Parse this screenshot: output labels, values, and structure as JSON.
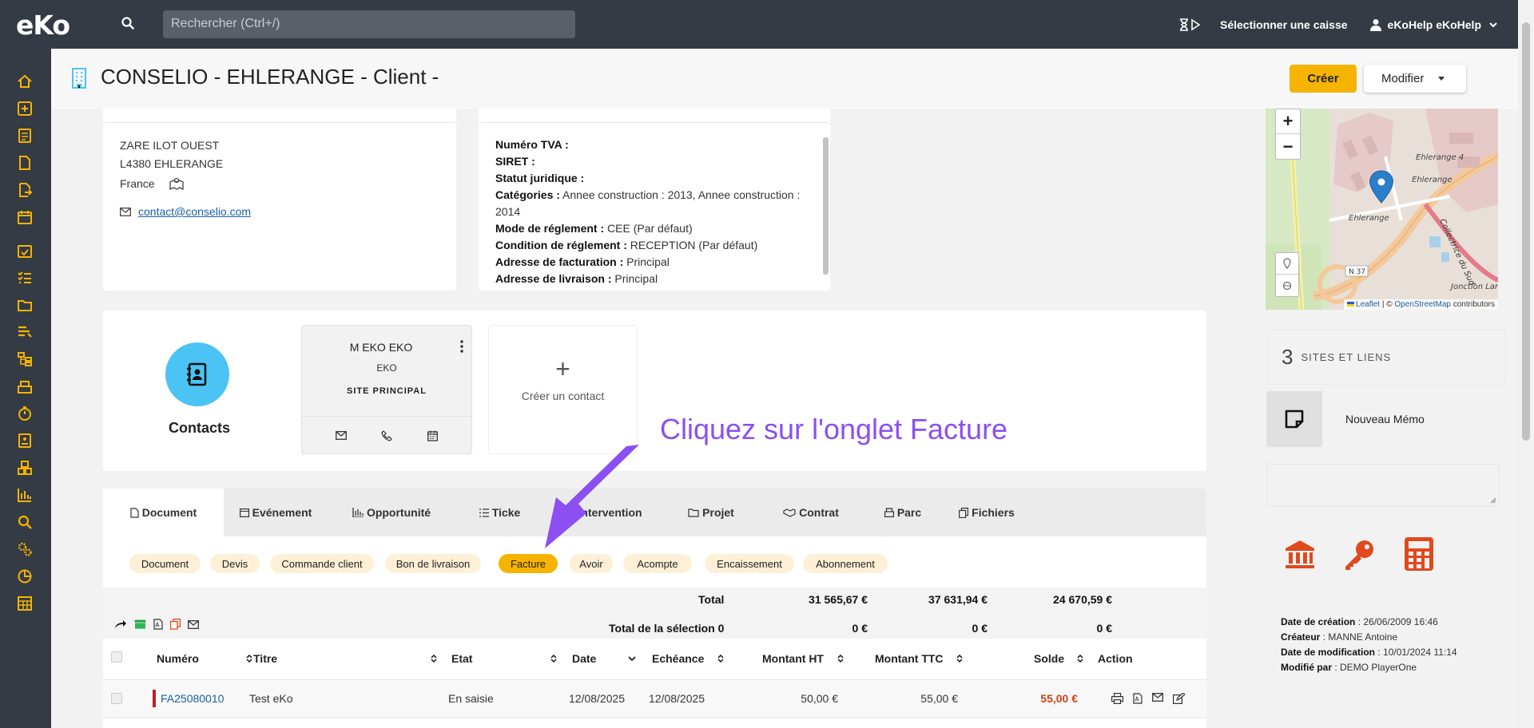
{
  "topbar": {
    "logo": "eKo",
    "search_placeholder": "Rechercher (Ctrl+/)",
    "caisse_label": "Sélectionner une caisse",
    "user_name": "eKoHelp eKoHelp"
  },
  "header": {
    "title": "CONSELIO - EHLERANGE - Client -",
    "create_label": "Créer",
    "modify_label": "Modifier"
  },
  "address": {
    "line1": "ZARE ILOT OUEST",
    "line2": "L4380 EHLERANGE",
    "country": "France",
    "email": "contact@conselio.com"
  },
  "info": {
    "tva_label": "Numéro TVA :",
    "siret_label": "SIRET :",
    "statut_label": "Statut juridique :",
    "categories_label": "Catégories :",
    "categories_value": " Annee construction : 2013, Annee construction : 2014",
    "reglement_label": "Mode de réglement :",
    "reglement_value": " CEE (Par défaut)",
    "condition_label": "Condition de réglement :",
    "condition_value": " RECEPTION (Par défaut)",
    "facturation_label": "Adresse de facturation :",
    "facturation_value": " Principal",
    "livraison_label": "Adresse de livraison :",
    "livraison_value": " Principal"
  },
  "map": {
    "zoom_in": "+",
    "zoom_out": "−",
    "attr_leaflet": "Leaflet",
    "attr_sep": " | © ",
    "attr_osm": "OpenStreetMap",
    "attr_contrib": " contributors",
    "labels": {
      "ehlerange4": "Ehlerange 4",
      "ehlerange": "Ehlerange",
      "ehlerange2": "Ehlerange",
      "n37": "N 37",
      "collectrice": "Collectrice du Sud",
      "jonction": "Jonction Lar"
    }
  },
  "sites": {
    "count": "3",
    "label": "SITES ET LIENS"
  },
  "memo": {
    "label": "Nouveau Mémo"
  },
  "meta": {
    "creation_label": "Date de création",
    "creation_value": " : 26/06/2009 16:46",
    "createur_label": "Créateur",
    "createur_value": " : MANNE Antoine",
    "modif_label": "Date de modification",
    "modif_value": " : 10/01/2024 11:14",
    "modifie_label": "Modifié par",
    "modifie_value": " : DEMO PlayerOne"
  },
  "contacts": {
    "title": "Contacts",
    "card": {
      "name": "M EKO EKO",
      "company": "EKO",
      "site": "SITE PRINCIPAL"
    },
    "create_plus": "+",
    "create_label": "Créer un contact"
  },
  "annotation": "Cliquez sur l'onglet Facture",
  "tabs": [
    {
      "label": "Document"
    },
    {
      "label": "Evénement"
    },
    {
      "label": "Opportunité"
    },
    {
      "label": "Ticke"
    },
    {
      "label": "Intervention"
    },
    {
      "label": "Projet"
    },
    {
      "label": "Contrat"
    },
    {
      "label": "Parc"
    },
    {
      "label": "Fichiers"
    }
  ],
  "pills": [
    {
      "label": "Document"
    },
    {
      "label": "Devis"
    },
    {
      "label": "Commande client"
    },
    {
      "label": "Bon de livraison"
    },
    {
      "label": "Facture"
    },
    {
      "label": "Avoir"
    },
    {
      "label": "Acompte"
    },
    {
      "label": "Encaissement"
    },
    {
      "label": "Abonnement"
    }
  ],
  "totals": {
    "total_label": "Total",
    "total_ht": "31 565,67 €",
    "total_ttc": "37 631,94 €",
    "total_solde": "24 670,59 €",
    "sel_label": "Total de la sélection 0",
    "sel_ht": "0 €",
    "sel_ttc": "0 €",
    "sel_solde": "0 €"
  },
  "table": {
    "headers": {
      "numero": "Numéro",
      "titre": "Titre",
      "etat": "Etat",
      "date": "Date",
      "echeance": "Echéance",
      "ht": "Montant HT",
      "ttc": "Montant TTC",
      "solde": "Solde",
      "action": "Action"
    },
    "rows": [
      {
        "numero": "FA25080010",
        "titre": "Test eKo",
        "etat": "En saisie",
        "date": "12/08/2025",
        "echeance": "12/08/2025",
        "ht": "50,00 €",
        "ttc": "55,00 €",
        "solde": "55,00 €"
      }
    ]
  },
  "colors": {
    "accent": "#f6b400",
    "sidebar": "#353b44",
    "icon": "#f6b400",
    "annotation": "#8b4ff2",
    "link": "#1a5fa8"
  }
}
